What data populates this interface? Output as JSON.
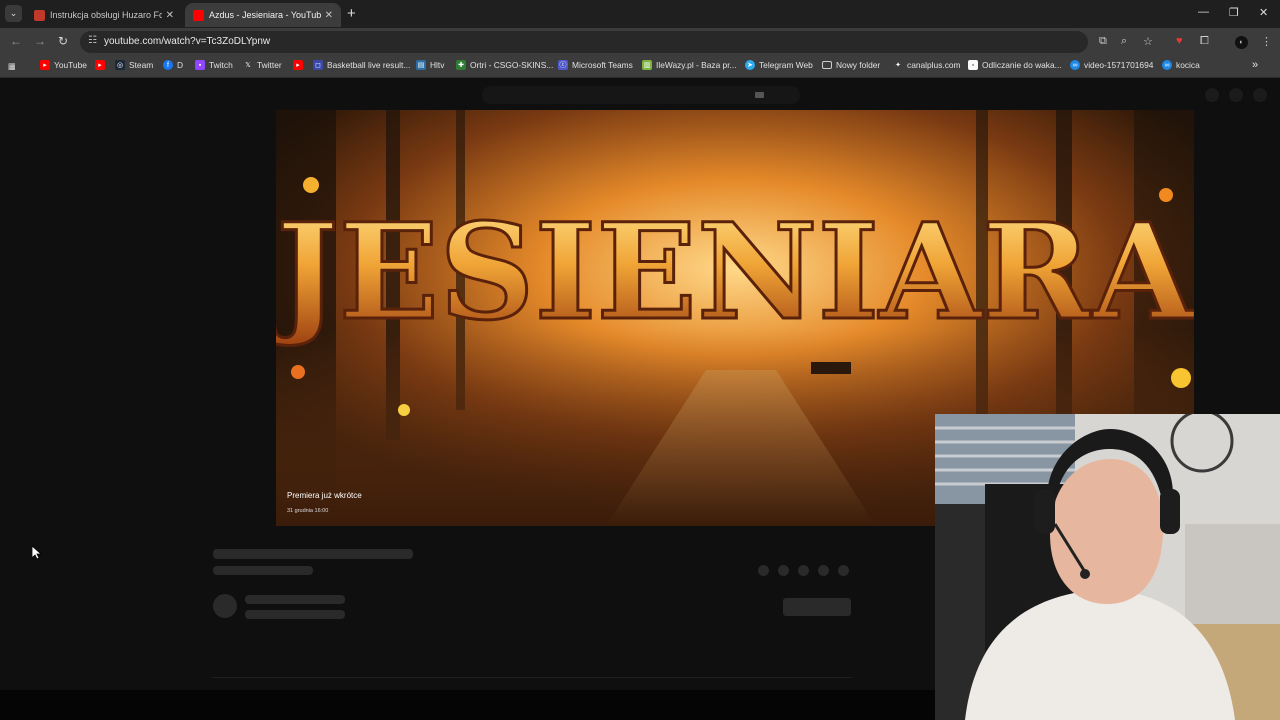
{
  "tabs": [
    {
      "title": "Instrukcja obsługi Huzaro Force",
      "active": false
    },
    {
      "title": "Azdus - Jesieniara - YouTube",
      "active": true
    }
  ],
  "address": {
    "url": "youtube.com/watch?v=Tc3ZoDLYpnw"
  },
  "bookmarks": [
    "YouTube",
    "",
    "Steam",
    "D",
    "Twitch",
    "Twitter",
    "",
    "Basketball live result...",
    "Hltv",
    "Ortri - CSGO-SKINS...",
    "Microsoft Teams",
    "IleWazy.pl - Baza pr...",
    "Telegram Web",
    "Nowy folder",
    "canalplus.com",
    "Odliczanie do waka...",
    "video-1571701694",
    "kocica"
  ],
  "video": {
    "thumbnail_title": "JESIENIARA",
    "premiere_label": "Premiera już wkrótce",
    "premiere_date": "31 grudnia 16:00"
  },
  "colors": {
    "youtube_red": "#ff0000",
    "accent_orange": "#e0791c",
    "background": "#0f0f0f"
  }
}
